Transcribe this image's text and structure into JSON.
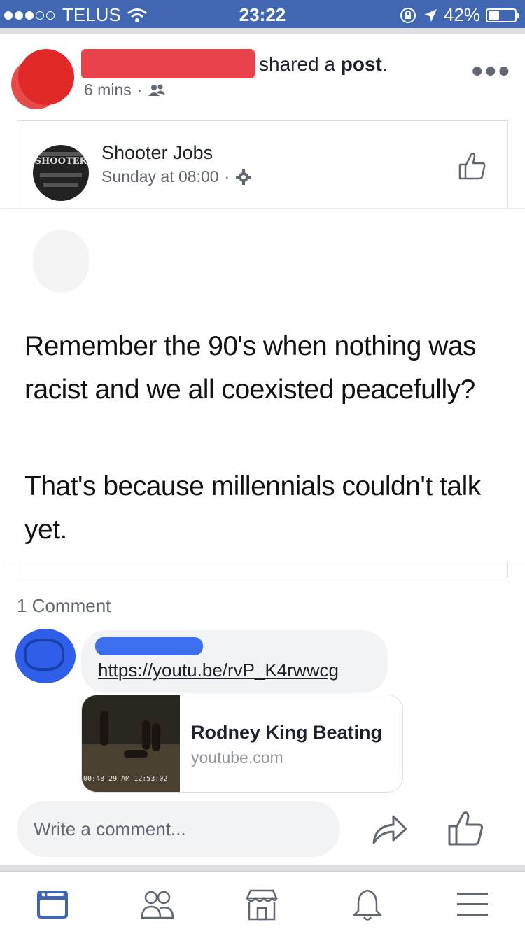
{
  "status_bar": {
    "carrier": "TELUS",
    "time": "23:22",
    "battery": "42%",
    "signal_bars_filled": 3,
    "battery_level": 0.42
  },
  "post": {
    "action_prefix": "shared a ",
    "action_object": "post",
    "action_suffix": ".",
    "time_ago": "6 mins",
    "audience_icon": "friends-icon",
    "more_icon": "more-options-icon"
  },
  "shared": {
    "page_name": "Shooter Jobs",
    "page_time": "Sunday at 08:00",
    "settings_icon": "gear-icon",
    "logo_text": "SHOOTER",
    "meme_paragraph_1": "Remember the 90's when nothing was racist and we all coexisted peacefully?",
    "meme_paragraph_2": "That's because millennials couldn't talk yet."
  },
  "comments": {
    "count_label": "1 Comment",
    "items": [
      {
        "link_text": "https://youtu.be/rvP_K4rwwcg",
        "preview": {
          "title": "Rodney King Beating",
          "domain": "youtube.com",
          "timecode": "00:48 29 AM 12:53:02"
        }
      }
    ]
  },
  "composer": {
    "placeholder": "Write a comment..."
  },
  "bottom_nav": {
    "items": [
      "news-feed-icon",
      "friends-icon",
      "marketplace-icon",
      "notifications-icon",
      "menu-icon"
    ],
    "active": "news-feed-icon",
    "accent_color": "#4267b2"
  },
  "colors": {
    "brand": "#4267b2",
    "redaction_red": "#e8434a",
    "redaction_blue": "#3b6ff0"
  }
}
